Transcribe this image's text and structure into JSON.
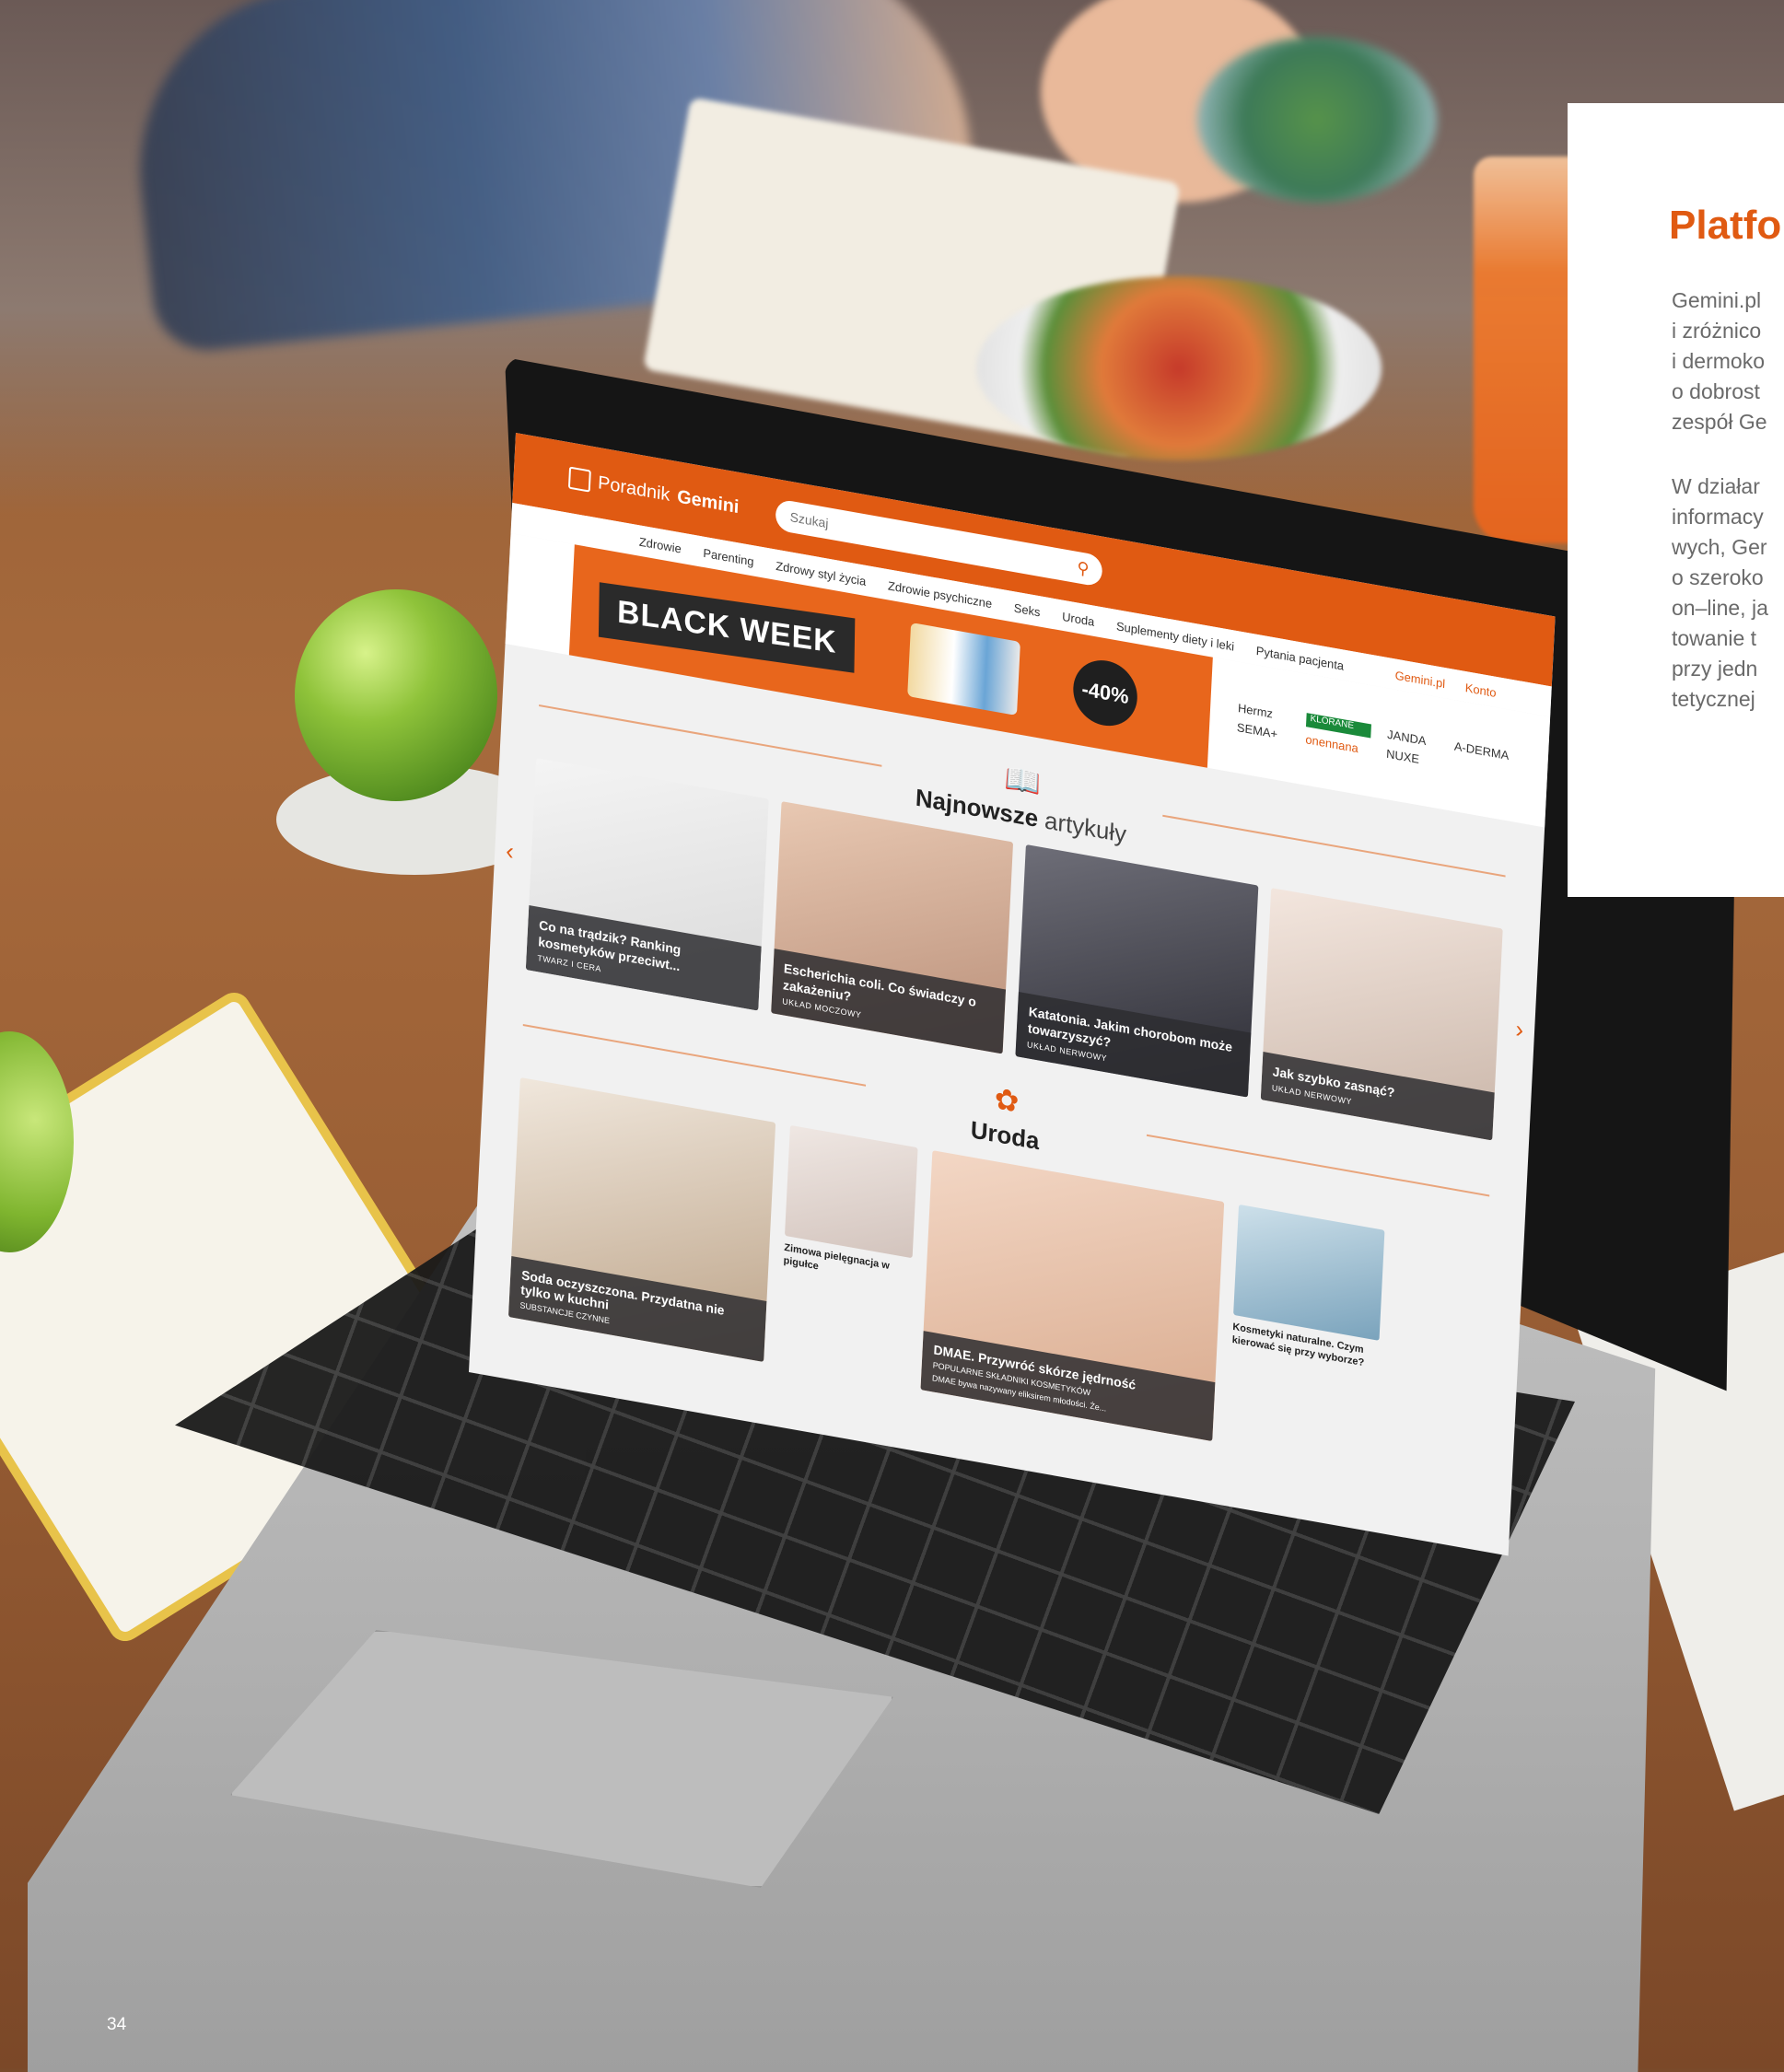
{
  "website": {
    "logo_prefix": "Poradnik",
    "logo_brand": "Gemini",
    "search_placeholder": "Szukaj",
    "nav": [
      "Zdrowie",
      "Parenting",
      "Zdrowy styl życia",
      "Zdrowie psychiczne",
      "Seks",
      "Uroda",
      "Suplementy diety i leki",
      "Pytania pacjenta"
    ],
    "nav_right": [
      "Gemini.pl",
      "Konto"
    ],
    "banner_label": "BLACK WEEK",
    "banner_discount": "-40%",
    "brands": [
      "Hermz",
      "KLORANE",
      "JANDA",
      "A-DERMA",
      "SEMA+",
      "onennana",
      "NUXE"
    ],
    "section1_bold": "Najnowsze",
    "section1_thin": "artykuły",
    "articles": [
      {
        "title": "Co na trądzik? Ranking kosmetyków przeciwt...",
        "category": "TWARZ I CERA"
      },
      {
        "title": "Escherichia coli. Co świadczy o zakażeniu?",
        "category": "UKŁAD MOCZOWY"
      },
      {
        "title": "Katatonia. Jakim chorobom może towarzyszyć?",
        "category": "UKŁAD NERWOWY"
      },
      {
        "title": "Jak szybko zasnąć?",
        "category": "UKŁAD NERWOWY"
      }
    ],
    "section2": "Uroda",
    "beauty": {
      "big1_title": "Soda oczyszczona. Przydatna nie tylko w kuchni",
      "big1_category": "SUBSTANCJE CZYNNE",
      "small1": "Zimowa pielęgnacja w pigułce",
      "face_title": "DMAE. Przywróć skórze jędrność",
      "face_category": "POPULARNE SKŁADNIKI KOSMETYKÓW",
      "face_excerpt": "DMAE bywa nazywany eliksirem młodości. Że...",
      "small2": "Kosmetyki naturalne. Czym kierować się przy wyborze?"
    }
  },
  "panel": {
    "title": "Platfo",
    "para1": [
      "Gemini.pl",
      "i zróżnico",
      "i dermoko",
      "o dobrost",
      "zespół Ge"
    ],
    "para2": [
      "W działar",
      "informacy",
      "wych, Ger",
      "o szeroko",
      "on–line, ja",
      "towanie t",
      "przy jedn",
      "tetycznej"
    ]
  },
  "page_number": "34",
  "colors": {
    "accent": "#e05a12",
    "panel_text": "#6a6a6a"
  }
}
